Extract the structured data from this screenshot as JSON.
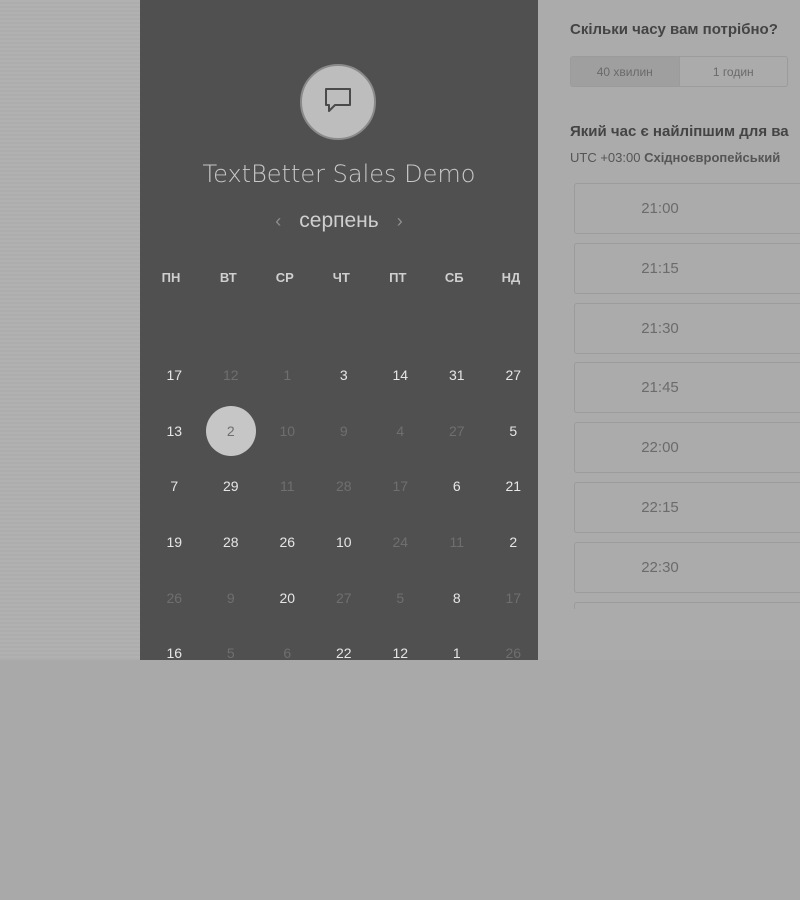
{
  "event": {
    "title": "TextBetter Sales Demo",
    "logo_icon": "chat-bubble-icon"
  },
  "calendar": {
    "month": "серпень",
    "prev_icon": "chevron-left-icon",
    "next_icon": "chevron-right-icon",
    "weekdays": [
      "ПН",
      "ВТ",
      "СР",
      "ЧТ",
      "ПТ",
      "СБ",
      "НД"
    ],
    "rows": [
      [
        {
          "d": "17"
        },
        {
          "d": "12",
          "dim": true
        },
        {
          "d": "1",
          "dim": true
        },
        {
          "d": "3"
        },
        {
          "d": "14"
        },
        {
          "d": "31"
        },
        {
          "d": "27"
        }
      ],
      [
        {
          "d": "13"
        },
        {
          "d": "2",
          "selected": true
        },
        {
          "d": "10",
          "dim": true
        },
        {
          "d": "9",
          "dim": true
        },
        {
          "d": "4",
          "dim": true
        },
        {
          "d": "27",
          "dim": true
        },
        {
          "d": "5"
        }
      ],
      [
        {
          "d": "7"
        },
        {
          "d": "29"
        },
        {
          "d": "11",
          "dim": true
        },
        {
          "d": "28",
          "dim": true
        },
        {
          "d": "17",
          "dim": true
        },
        {
          "d": "6"
        },
        {
          "d": "21"
        }
      ],
      [
        {
          "d": "19"
        },
        {
          "d": "28"
        },
        {
          "d": "26"
        },
        {
          "d": "10"
        },
        {
          "d": "24",
          "dim": true
        },
        {
          "d": "11",
          "dim": true
        },
        {
          "d": "2"
        }
      ],
      [
        {
          "d": "26",
          "dim": true
        },
        {
          "d": "9",
          "dim": true
        },
        {
          "d": "20"
        },
        {
          "d": "27",
          "dim": true
        },
        {
          "d": "5",
          "dim": true
        },
        {
          "d": "8"
        },
        {
          "d": "17",
          "dim": true
        }
      ],
      [
        {
          "d": "16"
        },
        {
          "d": "5",
          "dim": true
        },
        {
          "d": "6",
          "dim": true
        },
        {
          "d": "22"
        },
        {
          "d": "12"
        },
        {
          "d": "1"
        },
        {
          "d": "26",
          "dim": true
        }
      ]
    ]
  },
  "duration": {
    "question": "Скільки часу вам потрібно?",
    "options": [
      {
        "label": "40 хвилин",
        "active": true
      },
      {
        "label": "1 годин",
        "active": false
      }
    ]
  },
  "time": {
    "question": "Який час є найліпшим для ва",
    "tz_offset": "UTC +03:00",
    "tz_name": "Східноєвропейський",
    "slots": [
      "21:00",
      "21:15",
      "21:30",
      "21:45",
      "22:00",
      "22:15",
      "22:30",
      ""
    ]
  },
  "colors": {
    "selected_day": "#c6c6c6",
    "panel_dark": "#505050"
  }
}
